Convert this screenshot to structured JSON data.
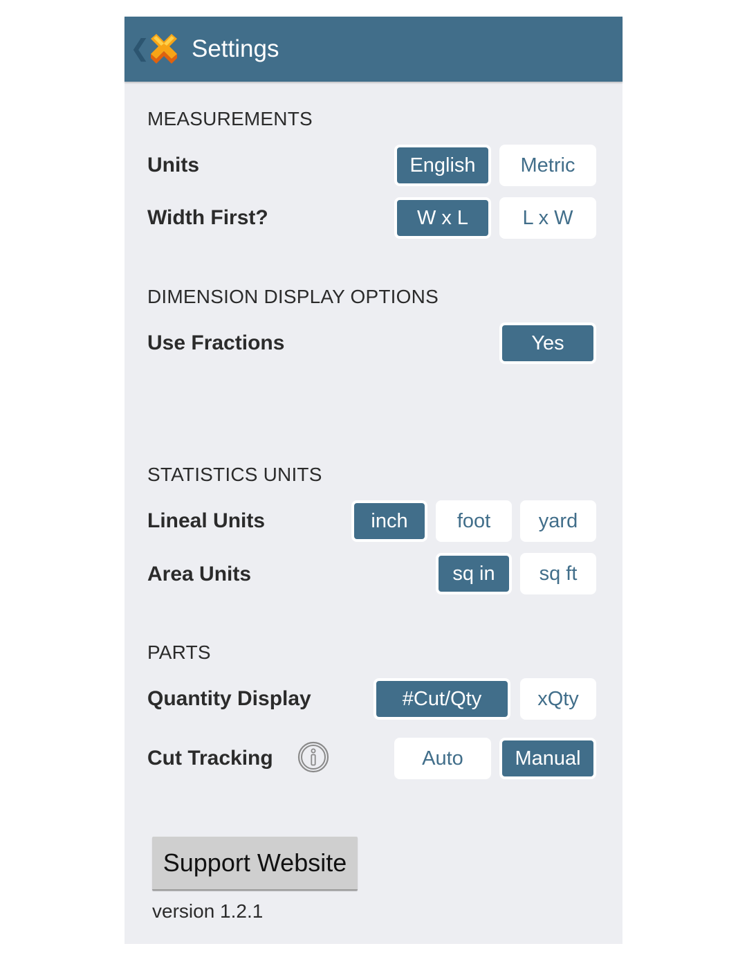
{
  "header": {
    "title": "Settings",
    "back_icon": "chevron-left-icon",
    "logo_icon": "orange-x-logo-icon"
  },
  "colors": {
    "accent": "#416E8A",
    "panel_background": "#EDEEF2",
    "unselected_button": "#FFFFFF",
    "support_button": "#CFCFCF"
  },
  "sections": {
    "measurements": {
      "heading": "MEASUREMENTS",
      "units": {
        "label": "Units",
        "options": [
          "English",
          "Metric"
        ],
        "selected": "English"
      },
      "width_first": {
        "label": "Width First?",
        "options": [
          "W x L",
          "L x W"
        ],
        "selected": "W x L"
      }
    },
    "dimension_display": {
      "heading": "DIMENSION DISPLAY OPTIONS",
      "use_fractions": {
        "label": "Use Fractions",
        "options": [
          "Yes"
        ],
        "selected": "Yes"
      }
    },
    "statistics_units": {
      "heading": "STATISTICS UNITS",
      "lineal_units": {
        "label": "Lineal Units",
        "options": [
          "inch",
          "foot",
          "yard"
        ],
        "selected": "inch"
      },
      "area_units": {
        "label": "Area Units",
        "options": [
          "sq in",
          "sq ft"
        ],
        "selected": "sq in"
      }
    },
    "parts": {
      "heading": "PARTS",
      "quantity_display": {
        "label": "Quantity Display",
        "options": [
          "#Cut/Qty",
          "xQty"
        ],
        "selected": "#Cut/Qty"
      },
      "cut_tracking": {
        "label": "Cut Tracking",
        "info_icon": "info-icon",
        "options": [
          "Auto",
          "Manual"
        ],
        "selected": "Manual"
      }
    }
  },
  "footer": {
    "support_button": "Support Website",
    "version": "version 1.2.1"
  }
}
